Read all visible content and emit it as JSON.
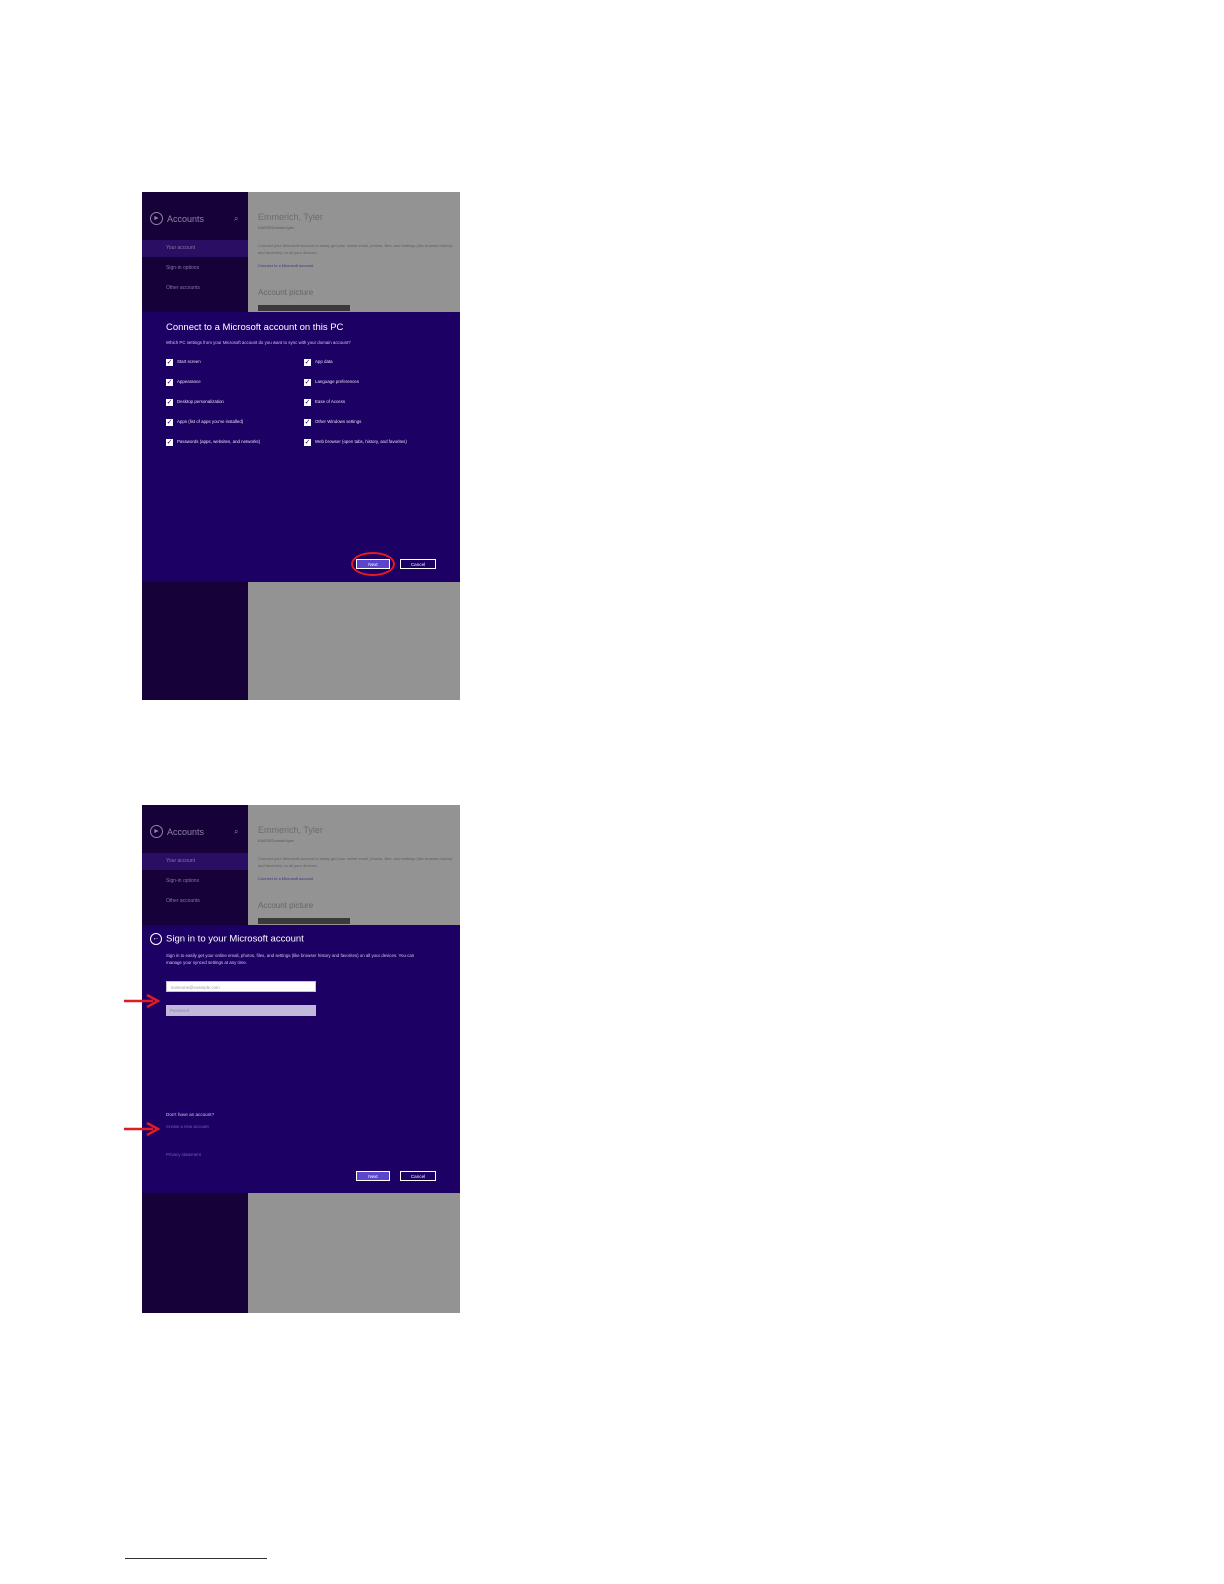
{
  "colors": {
    "accent": "#1d0064",
    "nav": "#160238",
    "annotation": "#e21b22"
  },
  "screens": [
    {
      "nav": {
        "title": "Accounts",
        "title_icon": "back-circle-icon",
        "search_icon": "search-icon",
        "items": [
          "Your account",
          "Sign-in options",
          "Other accounts"
        ]
      },
      "background": {
        "user_name": "Emmerich, Tyler",
        "user_sub": "KAEREDomain\\tyler",
        "description": "Connect your Microsoft account to easily get your online email, photos, files, and settings (like browser history and favorites) on all your devices.",
        "link": "Connect to a Microsoft account",
        "section_title": "Account picture"
      },
      "dialog": {
        "title": "Connect to a Microsoft account on this PC",
        "subtitle": "Which PC settings from your Microsoft account do you want to sync with your domain account?",
        "checkboxes_left": [
          "Start screen",
          "Appearance",
          "Desktop personalization",
          "Apps (list of apps you've installed)",
          "Passwords (apps, websites, and networks)"
        ],
        "checkboxes_right": [
          "App data",
          "Language preferences",
          "Ease of Access",
          "Other Windows settings",
          "Web browser (open tabs, history, and favorites)"
        ],
        "check_glyph": "✓",
        "next_label": "Next",
        "cancel_label": "Cancel"
      }
    },
    {
      "nav": {
        "title": "Accounts",
        "title_icon": "back-circle-icon",
        "search_icon": "search-icon",
        "items": [
          "Your account",
          "Sign-in options",
          "Other accounts"
        ]
      },
      "background": {
        "user_name": "Emmerich, Tyler",
        "user_sub": "KAEREDomain\\tyler",
        "description": "Connect your Microsoft account to easily get your online email, photos, files, and settings (like browser history and favorites) on all your devices.",
        "link": "Connect to a Microsoft account",
        "section_title": "Account picture"
      },
      "dialog": {
        "title": "Sign in to your Microsoft account",
        "subtitle": "Sign in to easily get your online email, photos, files, and settings (like browser history and favorites) on all your devices. You can manage your synced settings at any time.",
        "email_placeholder": "someone@example.com",
        "password_placeholder": "Password",
        "no_account_text": "Don't have an account?",
        "create_account_link": "Create a new account",
        "privacy_link": "Privacy statement",
        "next_label": "Next",
        "cancel_label": "Cancel"
      }
    }
  ]
}
